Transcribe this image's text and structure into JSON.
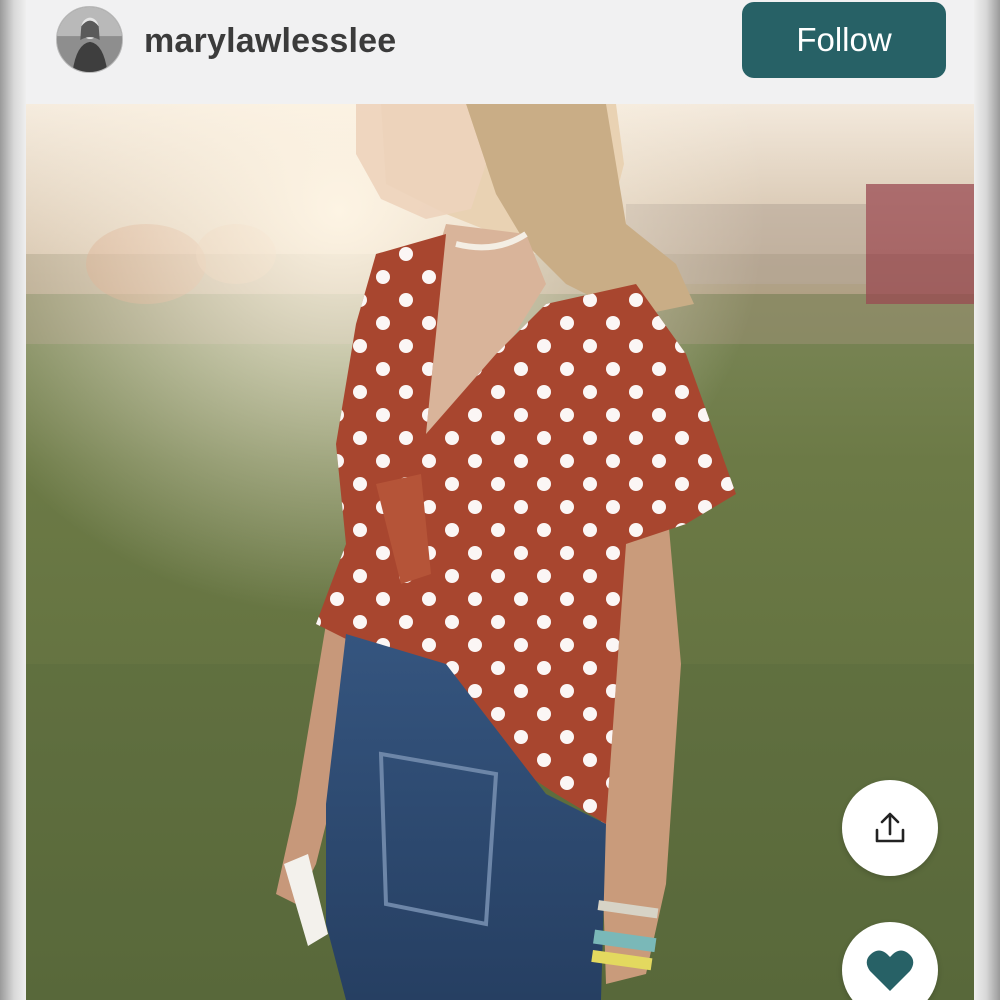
{
  "profile": {
    "username": "marylawlesslee",
    "avatar_icon": "profile-photo"
  },
  "header": {
    "follow_label": "Follow"
  },
  "colors": {
    "accent": "#276166",
    "header_bg": "#f1f1f2",
    "username_text": "#3b3b3b"
  },
  "actions": {
    "share_icon": "share-upload-icon",
    "like_icon": "heart-icon"
  }
}
